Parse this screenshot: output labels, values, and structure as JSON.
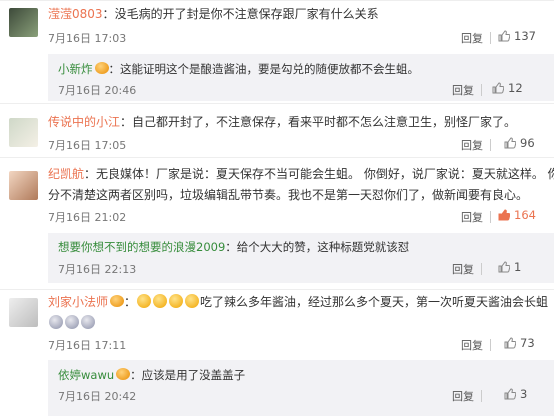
{
  "comments": [
    {
      "name": "滢滢0803",
      "sep": "：",
      "text": "没毛病的开了封是你不注意保存跟厂家有什么关系",
      "time": "7月16日 17:03",
      "reply": "回复",
      "likes": "137",
      "replies": [
        {
          "name": "小新炸",
          "sep": "：",
          "text": "这能证明这个是酿造酱油，要是勾兑的随便放都不会生蛆。",
          "time": "7月16日 20:46",
          "reply": "回复",
          "likes": "12"
        }
      ]
    },
    {
      "name": "传说中的小江",
      "sep": "：",
      "text": "自己都开封了，不注意保存，看来平时都不怎么注意卫生，别怪厂家了。",
      "time": "7月16日 17:05",
      "reply": "回复",
      "likes": "96",
      "replies": []
    },
    {
      "name": "纪凯航",
      "sep": "：",
      "text": "无良媒体！厂家是说：夏天保存不当可能会生蛆。 你倒好，说厂家说：夏天就这样。 你",
      "text2": "分不清楚这两者区别吗，垃圾编辑乱带节奏。我也不是第一天怼你们了，做新闻要有良心。",
      "time": "7月16日 21:02",
      "reply": "回复",
      "likes": "164",
      "replies": [
        {
          "name": "想要你想不到的想要的浪漫2009",
          "sep": "：",
          "text": "给个大大的赞，这种标题党就该怼",
          "time": "7月16日 22:13",
          "reply": "回复",
          "likes": "1"
        }
      ]
    },
    {
      "name": "刘家小法师",
      "sep": "：",
      "text": "吃了辣么多年酱油，经过那么多个夏天，第一次听夏天酱油会长蛆",
      "time": "7月16日 17:11",
      "reply": "回复",
      "likes": "73",
      "replies": [
        {
          "name": "依婷wawu",
          "sep": "：",
          "text": "应该是用了没盖盖子",
          "time": "7月16日 20:42",
          "reply": "回复",
          "likes": "3"
        }
      ]
    }
  ],
  "icons": {
    "like": "thumb-up-icon",
    "emoji": "smiley-emoji-icon",
    "vip": "vip-badge-icon"
  },
  "colors": {
    "name": "#eb7350",
    "reply_name": "#368c3b",
    "liked": "#eb7350"
  }
}
